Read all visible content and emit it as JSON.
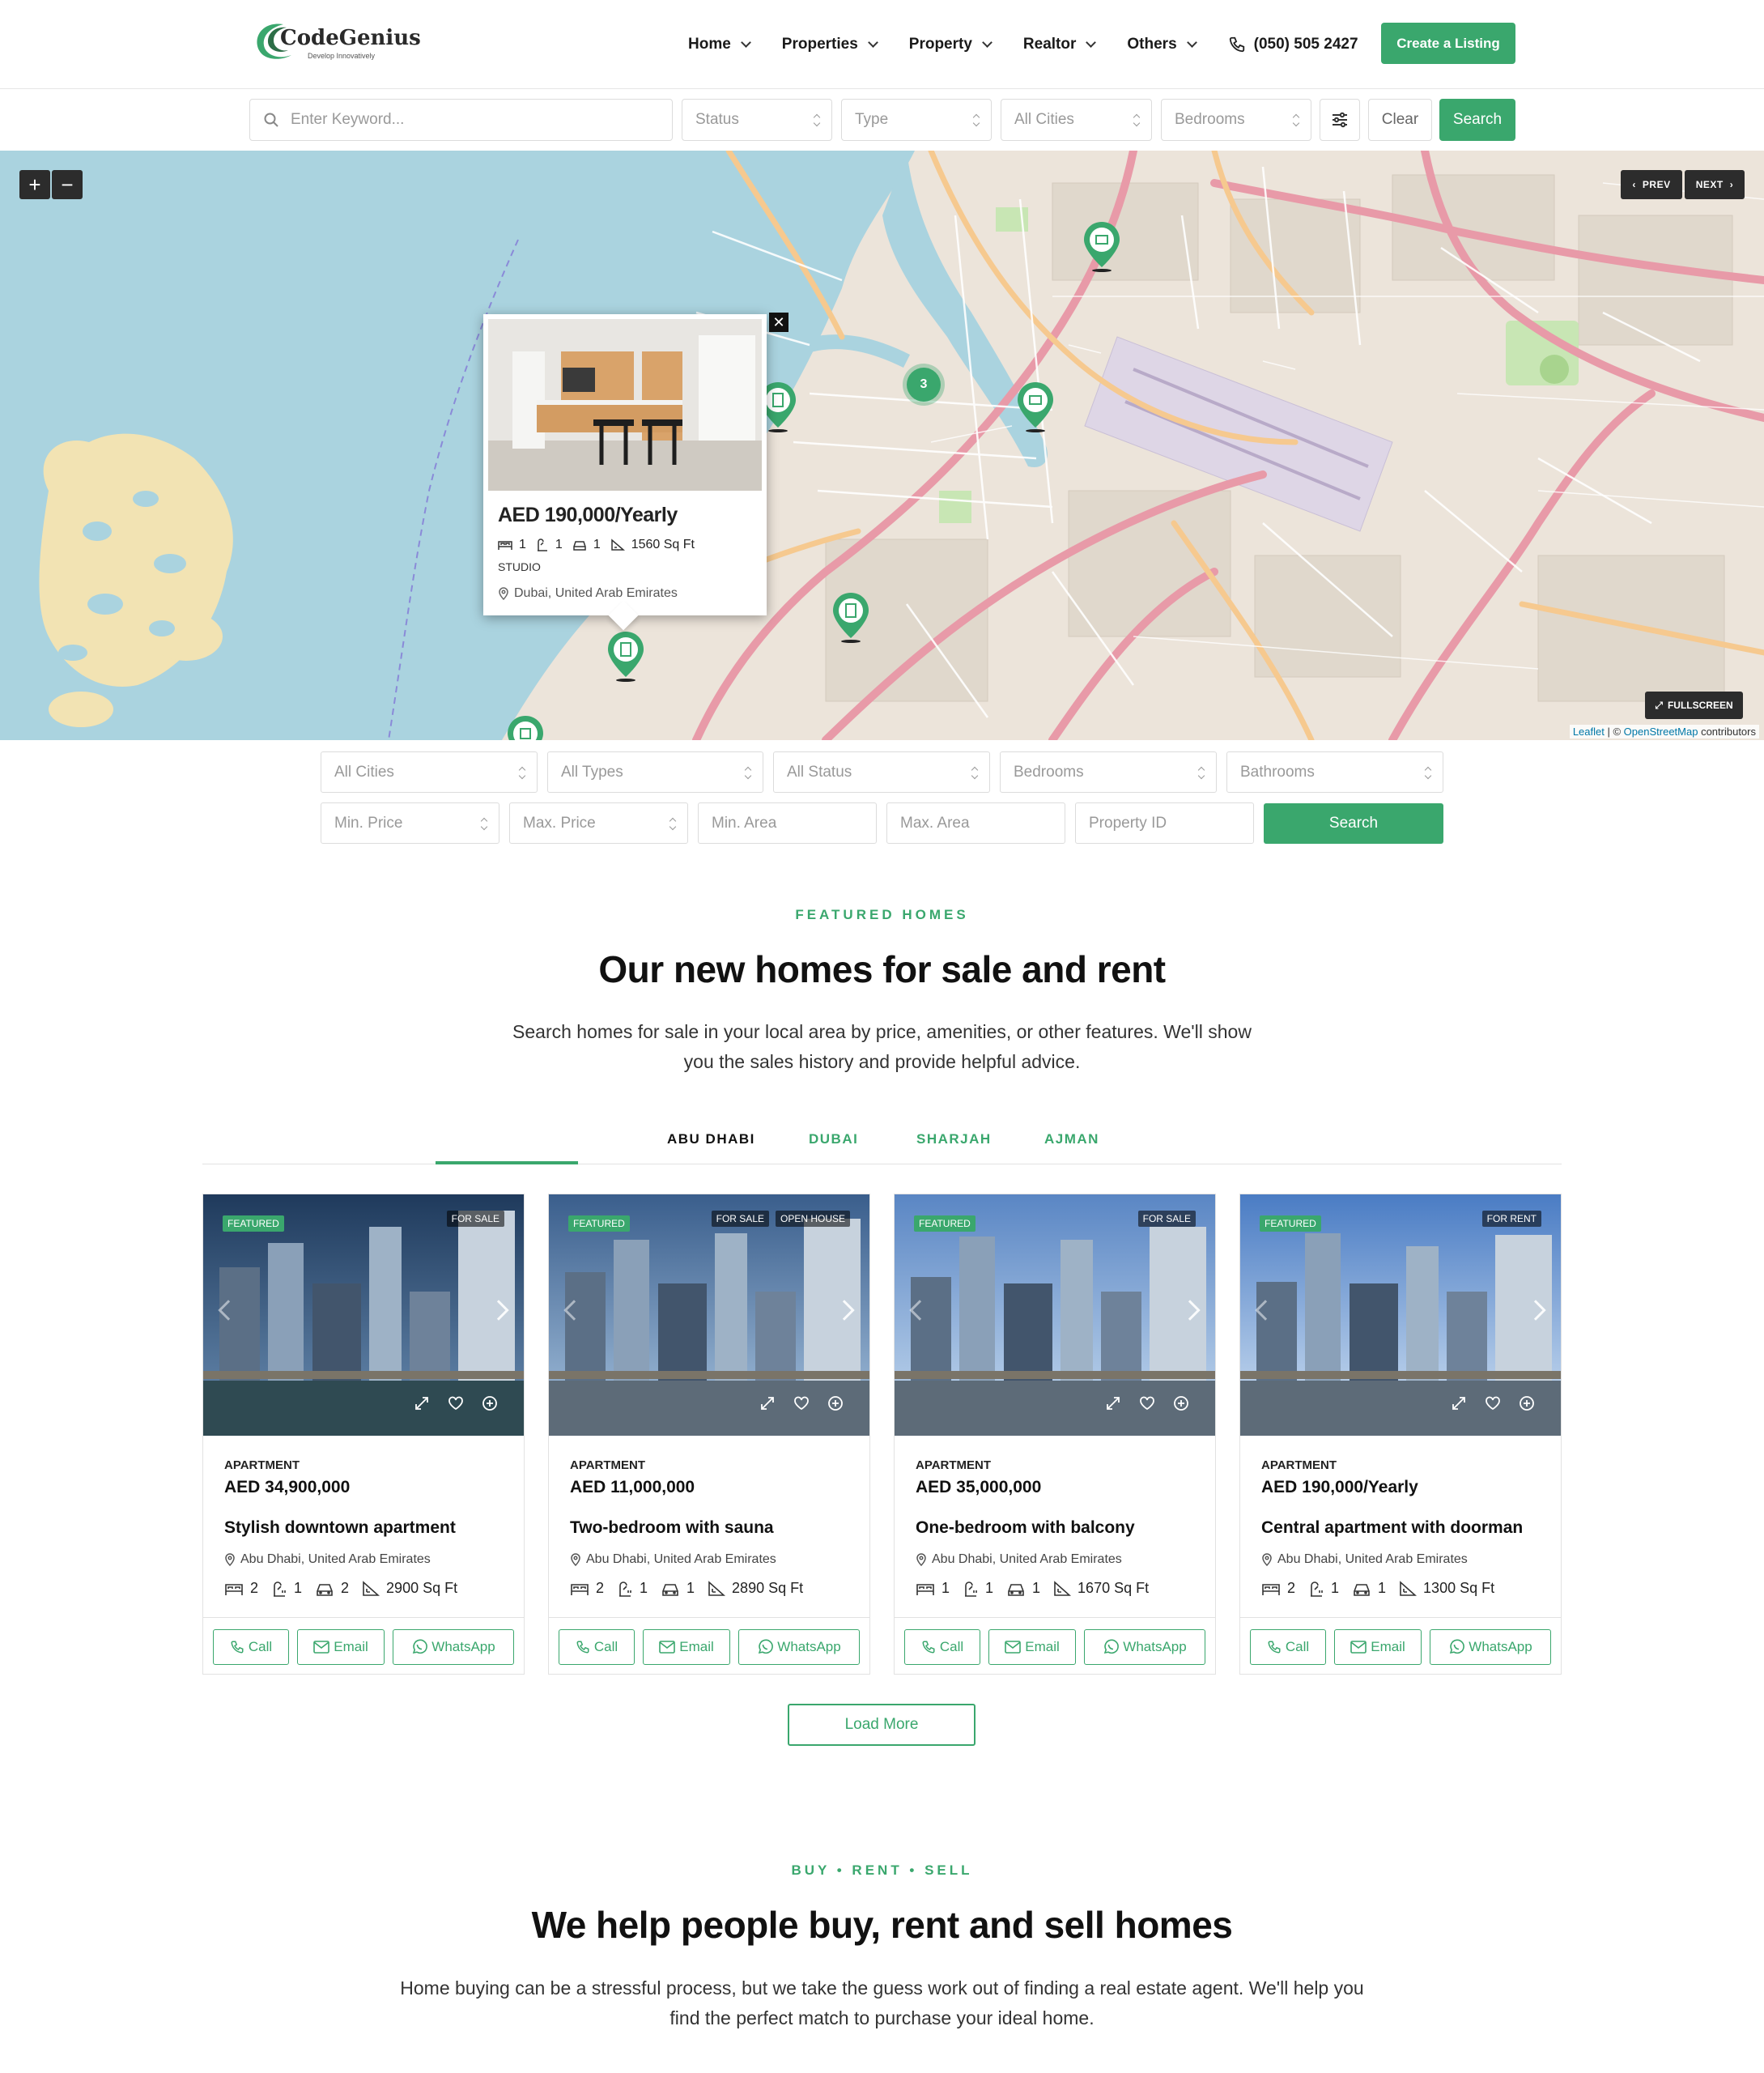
{
  "header": {
    "logo_text": "CodeGenius",
    "logo_sub": "Develop Innovatively",
    "nav": [
      {
        "label": "Home"
      },
      {
        "label": "Properties"
      },
      {
        "label": "Property"
      },
      {
        "label": "Realtor"
      },
      {
        "label": "Others"
      }
    ],
    "phone": "(050) 505 2427",
    "create_listing": "Create a Listing"
  },
  "top_search": {
    "keyword_placeholder": "Enter Keyword...",
    "status": "Status",
    "type": "Type",
    "cities": "All Cities",
    "bedrooms": "Bedrooms",
    "clear": "Clear",
    "search": "Search"
  },
  "map": {
    "zoom_in": "+",
    "zoom_out": "−",
    "prev": "PREV",
    "next": "NEXT",
    "fullscreen": "FULLSCREEN",
    "attribution_leaflet": "Leaflet",
    "attribution_sep": " | © ",
    "attribution_osm": "OpenStreetMap",
    "attribution_tail": " contributors",
    "cluster_count": "3",
    "popup": {
      "price": "AED 190,000/Yearly",
      "beds": "1",
      "baths": "1",
      "garage": "1",
      "area": "1560 Sq Ft",
      "type": "STUDIO",
      "address": "Dubai, United Arab Emirates"
    }
  },
  "advanced_search": {
    "cities": "All Cities",
    "types": "All Types",
    "status": "All Status",
    "bedrooms": "Bedrooms",
    "bathrooms": "Bathrooms",
    "min_price": "Min. Price",
    "max_price": "Max. Price",
    "min_area": "Min. Area",
    "max_area": "Max. Area",
    "property_id": "Property ID",
    "search": "Search"
  },
  "featured": {
    "eyebrow": "FEATURED HOMES",
    "title": "Our new homes for sale and rent",
    "desc_line1": "Search homes for sale in your local area by price, amenities, or other features. We'll show",
    "desc_line2": "you the sales history and provide helpful advice.",
    "tabs": [
      "ABU DHABI",
      "DUBAI",
      "SHARJAH",
      "AJMAN"
    ],
    "cards": [
      {
        "featured": "FEATURED",
        "status": "FOR SALE",
        "status2": "",
        "type": "APARTMENT",
        "price": "AED 34,900,000",
        "title": "Stylish downtown apartment",
        "address": "Abu Dhabi, United Arab Emirates",
        "beds": "2",
        "baths": "1",
        "garage": "2",
        "area": "2900 Sq Ft"
      },
      {
        "featured": "FEATURED",
        "status": "FOR SALE",
        "status2": "OPEN HOUSE",
        "type": "APARTMENT",
        "price": "AED 11,000,000",
        "title": "Two-bedroom with sauna",
        "address": "Abu Dhabi, United Arab Emirates",
        "beds": "2",
        "baths": "1",
        "garage": "1",
        "area": "2890 Sq Ft"
      },
      {
        "featured": "FEATURED",
        "status": "FOR SALE",
        "status2": "",
        "type": "APARTMENT",
        "price": "AED 35,000,000",
        "title": "One-bedroom with balcony",
        "address": "Abu Dhabi, United Arab Emirates",
        "beds": "1",
        "baths": "1",
        "garage": "1",
        "area": "1670 Sq Ft"
      },
      {
        "featured": "FEATURED",
        "status": "FOR RENT",
        "status2": "",
        "type": "APARTMENT",
        "price": "AED 190,000/Yearly",
        "title": "Central apartment with doorman",
        "address": "Abu Dhabi, United Arab Emirates",
        "beds": "2",
        "baths": "1",
        "garage": "1",
        "area": "1300 Sq Ft"
      }
    ],
    "actions": {
      "call": "Call",
      "email": "Email",
      "whatsapp": "WhatsApp"
    },
    "load_more": "Load More"
  },
  "help": {
    "eyebrow": "BUY • RENT • SELL",
    "title": "We help people buy, rent and sell homes",
    "desc_line1": "Home buying can be a stressful process, but we take the guess work out of finding a real estate agent. We'll help you",
    "desc_line2": "find the perfect match to purchase your ideal home."
  },
  "colors": {
    "accent": "#3aa76d",
    "dark": "#2c2c2c",
    "water": "#aad3df"
  }
}
